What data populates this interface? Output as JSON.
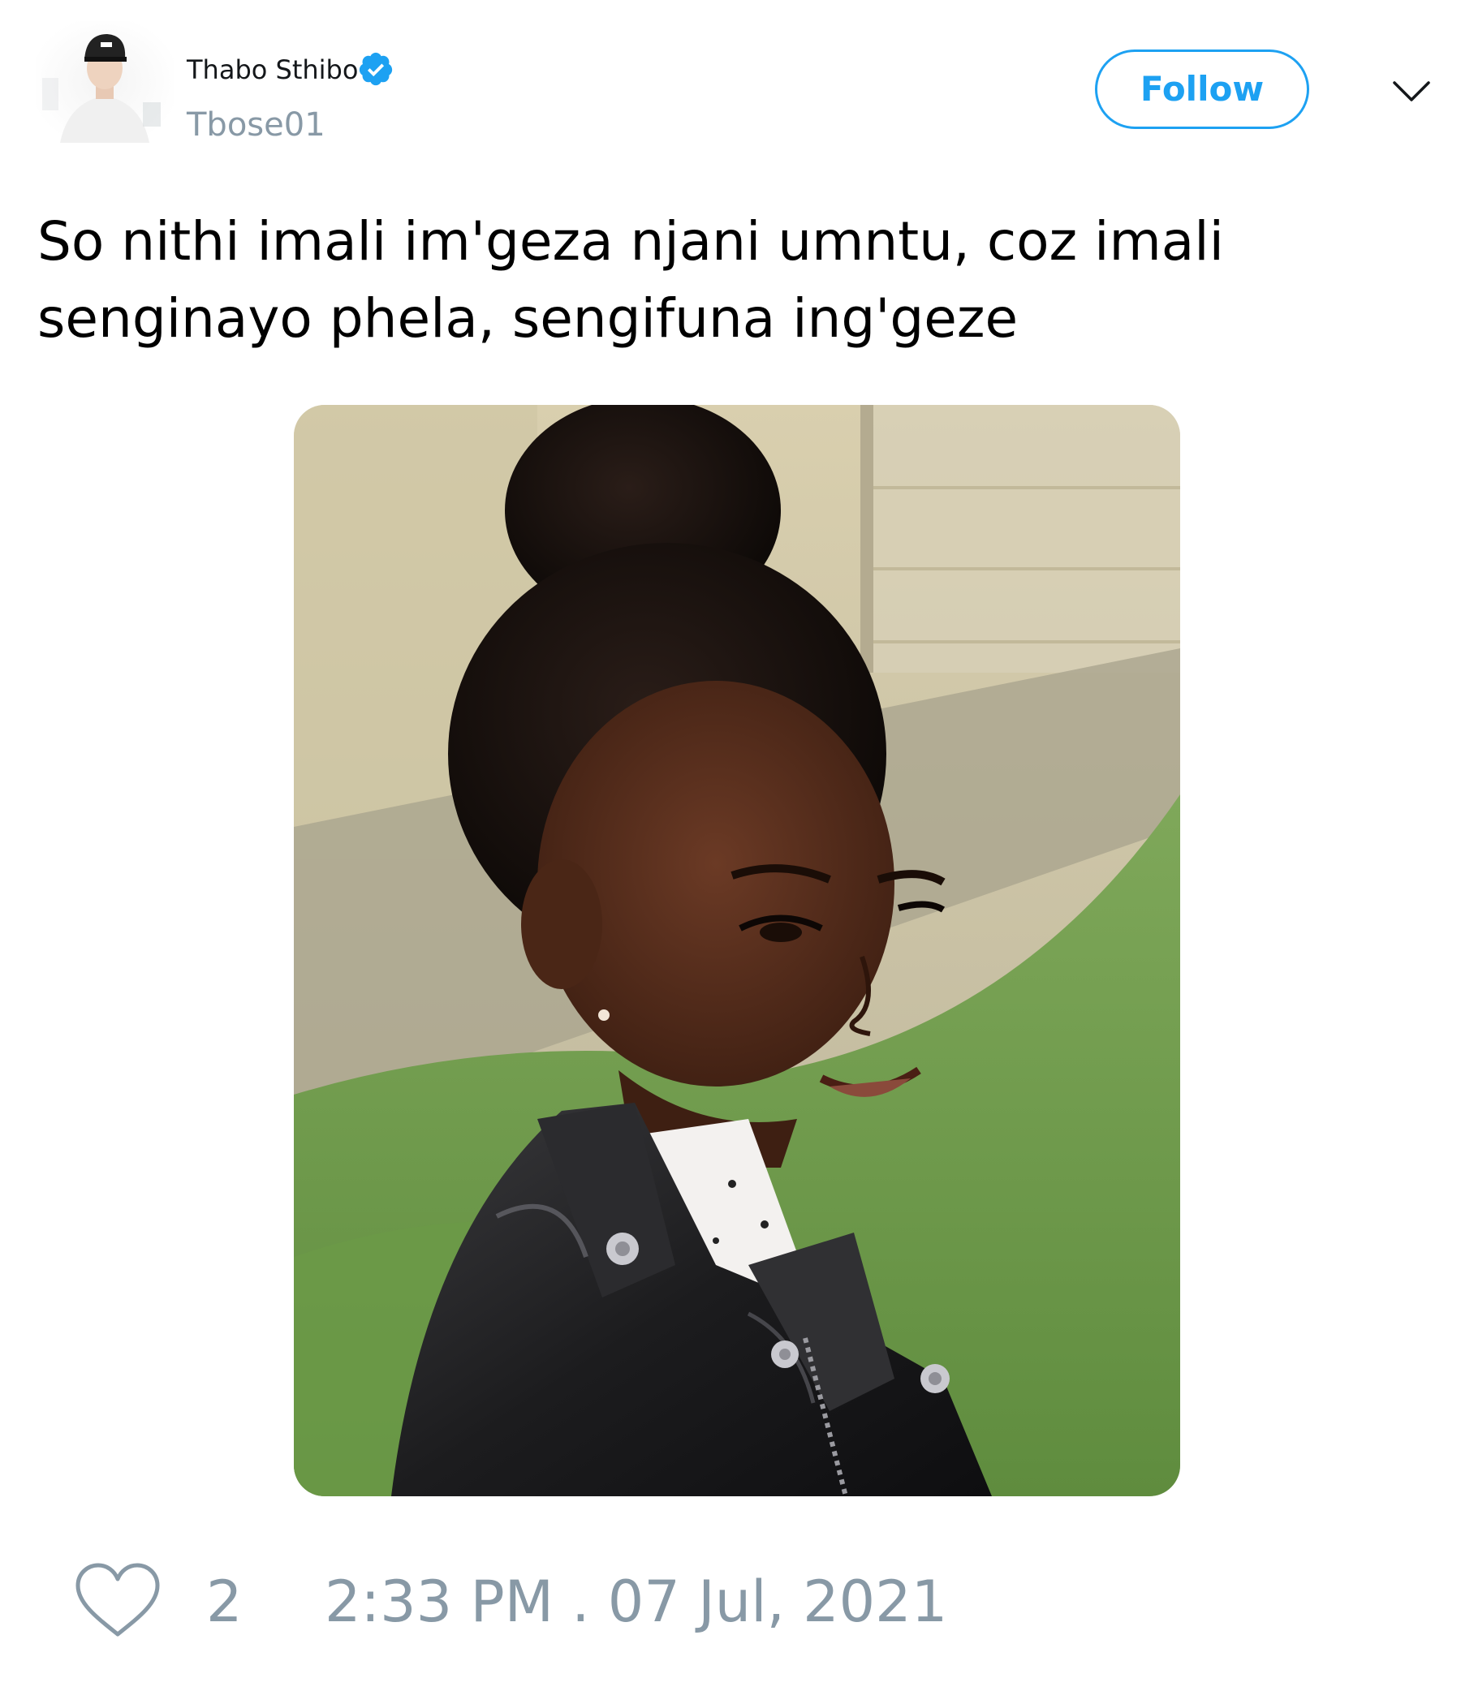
{
  "user": {
    "display_name": "Thabo Sthibo",
    "handle": "Tbose01",
    "verified": true,
    "avatar_icon": "user-avatar-photo"
  },
  "actions": {
    "follow_label": "Follow",
    "menu_icon": "chevron-down-icon"
  },
  "tweet": {
    "text": "So nithi imali im'geza njani umntu, coz imali senginayo phela, sengifuna ing'geze",
    "media_icon": "photo-girl-leather-jacket"
  },
  "footer": {
    "like_icon": "heart-icon",
    "like_count": "2",
    "timestamp": "2:33 PM . 07 Jul, 2021"
  },
  "colors": {
    "accent": "#1da1f2",
    "muted": "#8899a6",
    "text": "#000000"
  }
}
